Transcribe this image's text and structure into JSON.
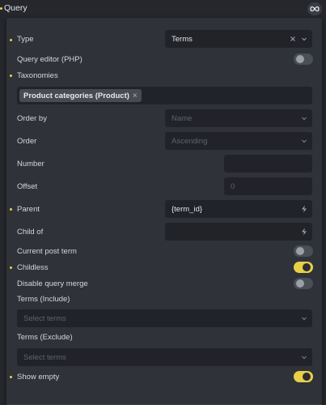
{
  "header": {
    "title": "Query",
    "loop_icon": "infinity-icon"
  },
  "fields": {
    "type": {
      "label": "Type",
      "value": "Terms"
    },
    "query_editor": {
      "label": "Query editor (PHP)",
      "enabled": false
    },
    "taxonomies": {
      "label": "Taxonomies",
      "chips": [
        "Product categories (Product)"
      ]
    },
    "order_by": {
      "label": "Order by",
      "placeholder": "Name"
    },
    "order": {
      "label": "Order",
      "placeholder": "Ascending"
    },
    "number": {
      "label": "Number",
      "value": ""
    },
    "offset": {
      "label": "Offset",
      "placeholder": "0"
    },
    "parent": {
      "label": "Parent",
      "value": "{term_id}"
    },
    "child_of": {
      "label": "Child of",
      "value": ""
    },
    "current_post_term": {
      "label": "Current post term",
      "enabled": false
    },
    "childless": {
      "label": "Childless",
      "enabled": true
    },
    "disable_query_merge": {
      "label": "Disable query merge",
      "enabled": false
    },
    "terms_include": {
      "label": "Terms (Include)",
      "placeholder": "Select terms"
    },
    "terms_exclude": {
      "label": "Terms (Exclude)",
      "placeholder": "Select terms"
    },
    "show_empty": {
      "label": "Show empty",
      "enabled": true
    }
  },
  "colors": {
    "accent": "#e8cf48",
    "panel": "#2f3238",
    "field": "#212328"
  }
}
